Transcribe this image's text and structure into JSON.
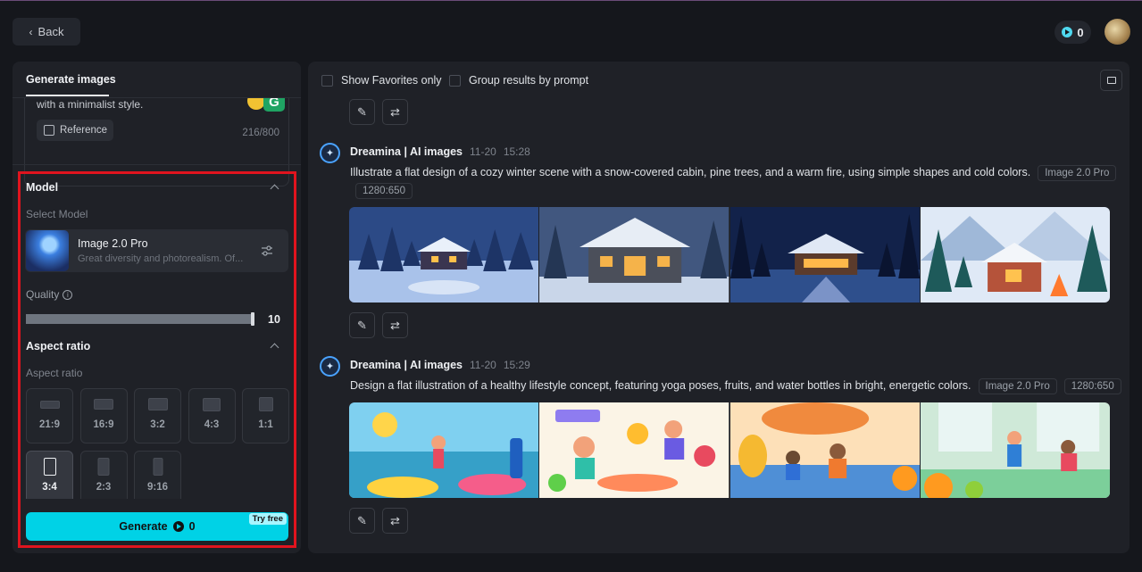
{
  "header": {
    "back_label": "Back",
    "credits": "0"
  },
  "left_panel": {
    "tab_label": "Generate images",
    "prompt_text": "with a minimalist style.",
    "reference_label": "Reference",
    "char_count": "216/800",
    "model_section": {
      "title": "Model",
      "select_label": "Select Model",
      "model_name": "Image 2.0 Pro",
      "model_desc": "Great diversity and photorealism. Of..."
    },
    "quality": {
      "label": "Quality",
      "value": "10",
      "level": 1.0
    },
    "aspect_section": {
      "title": "Aspect ratio",
      "sub_label": "Aspect ratio",
      "options": [
        {
          "label": "21:9",
          "selected": false
        },
        {
          "label": "16:9",
          "selected": false
        },
        {
          "label": "3:2",
          "selected": false
        },
        {
          "label": "4:3",
          "selected": false
        },
        {
          "label": "1:1",
          "selected": false
        },
        {
          "label": "3:4",
          "selected": true
        },
        {
          "label": "2:3",
          "selected": false
        },
        {
          "label": "9:16",
          "selected": false
        }
      ]
    },
    "generate": {
      "label": "Generate",
      "cost": "0",
      "badge": "Try free"
    }
  },
  "right_panel": {
    "show_favorites_label": "Show Favorites only",
    "group_by_prompt_label": "Group results by prompt",
    "generations": [
      {
        "author": "Dreamina | AI images",
        "date": "11-20",
        "time": "15:28",
        "prompt": "Illustrate a flat design of a cozy winter scene with a snow-covered cabin, pine trees, and a warm fire, using simple shapes and cold colors.",
        "model_tag": "Image 2.0 Pro",
        "size_tag": "1280:650"
      },
      {
        "author": "Dreamina | AI images",
        "date": "11-20",
        "time": "15:29",
        "prompt": "Design a flat illustration of a healthy lifestyle concept, featuring yoga poses, fruits, and water bottles in bright, energetic colors.",
        "model_tag": "Image 2.0 Pro",
        "size_tag": "1280:650"
      }
    ]
  }
}
